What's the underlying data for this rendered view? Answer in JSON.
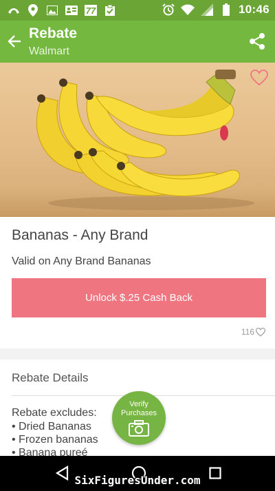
{
  "status_bar": {
    "time": "10:46",
    "left_icons": [
      "missed-call-icon",
      "location-pin-icon",
      "image-icon",
      "contact-card-icon",
      "news-77-icon",
      "clipboard-check-icon"
    ],
    "right_icons": [
      "alarm-icon",
      "wifi-icon",
      "signal-icon",
      "battery-icon"
    ]
  },
  "app_bar": {
    "title": "Rebate",
    "subtitle": "Walmart"
  },
  "product": {
    "name": "Bananas - Any Brand",
    "valid_text": "Valid on Any Brand Bananas",
    "unlock_label": "Unlock $.25 Cash Back",
    "like_count": "116"
  },
  "details": {
    "title": "Rebate Details",
    "excludes_title": "Rebate excludes:",
    "excludes": [
      "• Dried Bananas",
      "• Frozen bananas",
      "• Banana pureé"
    ]
  },
  "verify_button": {
    "line1": "Verify",
    "line2": "Purchases"
  },
  "watermark": "SixFiguresUnder.com",
  "colors": {
    "status_bar": "#6aa536",
    "app_bar": "#74b83f",
    "unlock_button": "#ef7681",
    "verify_button": "#76b543"
  }
}
